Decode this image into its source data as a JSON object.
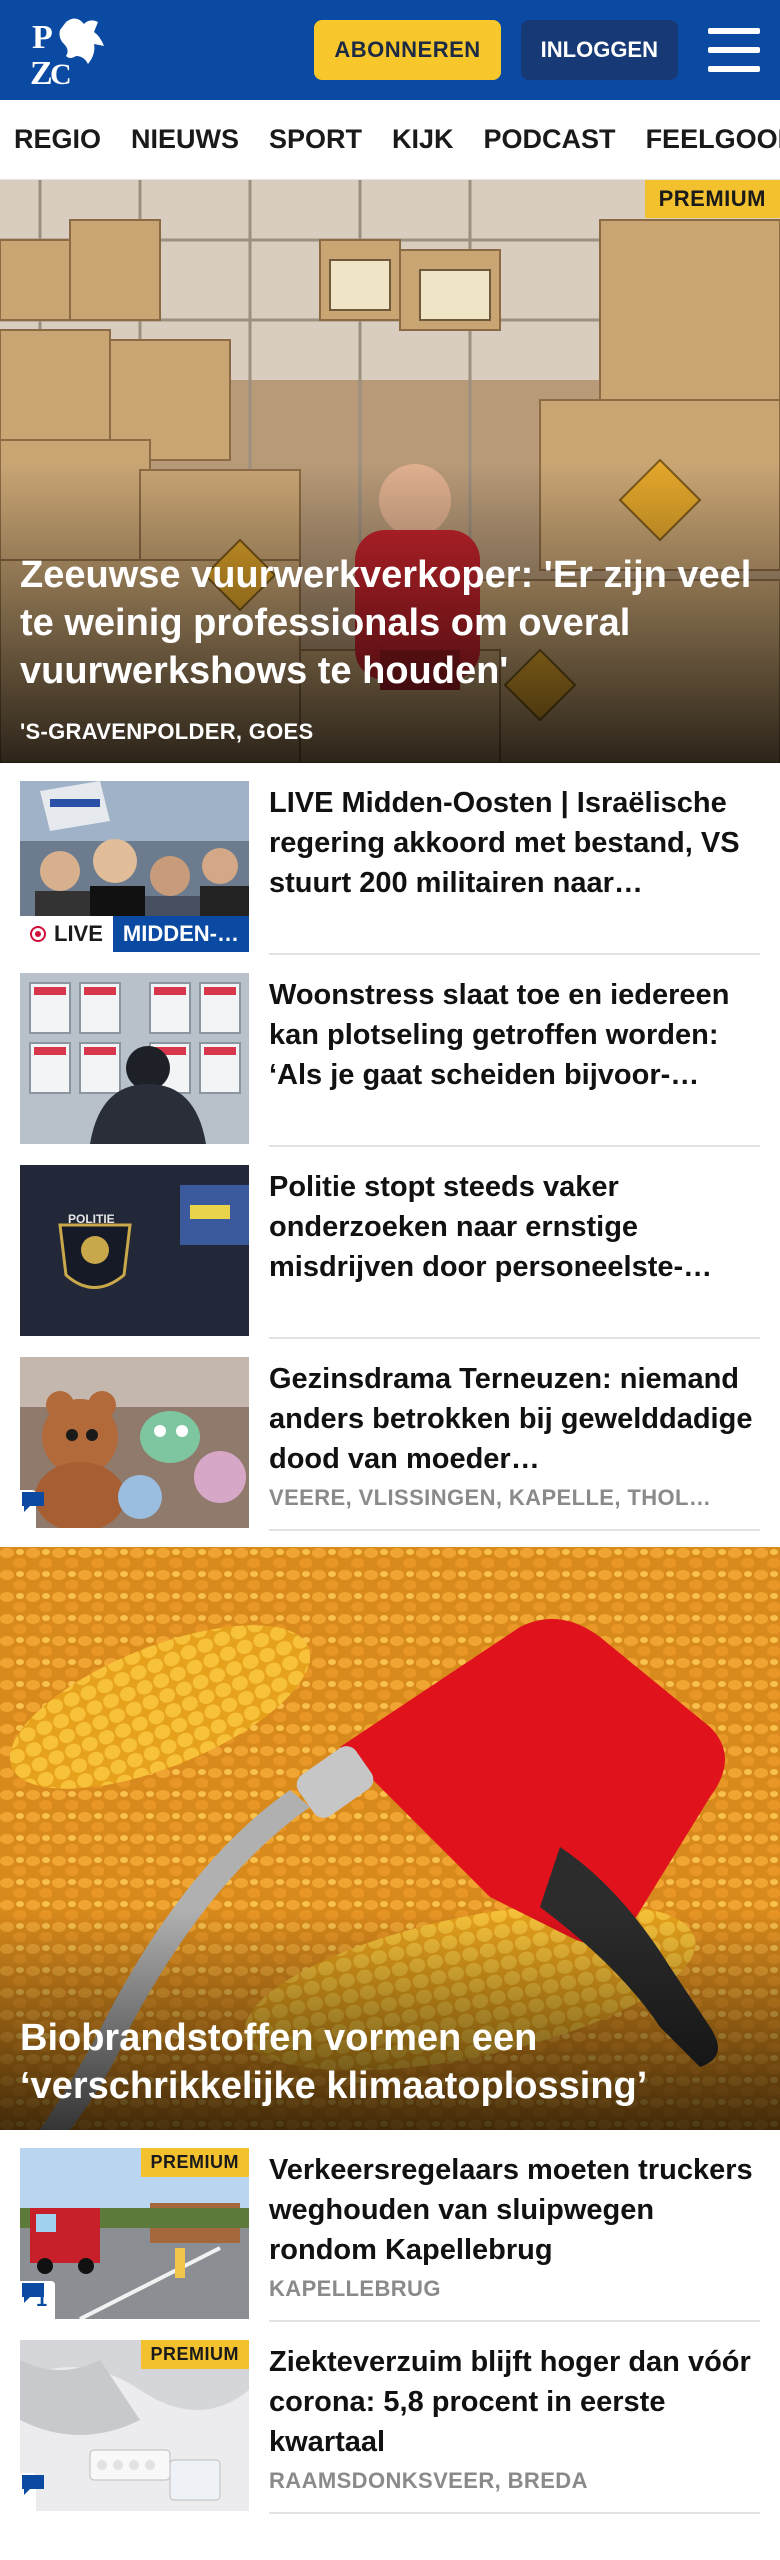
{
  "header": {
    "brand": "PZC",
    "subscribe_label": "ABONNEREN",
    "login_label": "INLOGGEN",
    "brand_color": "#0b4aa2",
    "accent_color": "#f7c72b"
  },
  "nav": {
    "items": [
      "REGIO",
      "NIEUWS",
      "SPORT",
      "KIJK",
      "PODCAST",
      "FEELGOOD"
    ],
    "more": "I"
  },
  "hero": {
    "badge": "PREMIUM",
    "title": "Zeeuwse vuurwerkverkoper: 'Er zijn veel te weinig professionals om overal vuurwerkshows te houden'",
    "location": "'S-GRAVENPOLDER, GOES"
  },
  "articles": [
    {
      "title": "LIVE Midden-Oosten | Israëlische regering akkoord met bestand, VS stuurt 200 militairen naar…",
      "live_label": "LIVE",
      "topic": "MIDDEN-…"
    },
    {
      "title": "Woonstress slaat toe en iedereen kan plotseling getroffen worden: ‘Als je gaat scheiden bijvoor-…"
    },
    {
      "title": "Politie stopt steeds vaker onderzoeken naar ernstige misdrijven door personeelste-…"
    },
    {
      "title": "Gezinsdrama Terneuzen: niemand anders betrokken bij gewelddadige dood van moeder…",
      "location": "VEERE, VLISSINGEN, KAPELLE, THOL…"
    }
  ],
  "feature": {
    "title": "Biobrandstoffen vormen een ‘verschrikkelijke klimaatoplossing’"
  },
  "articles2": [
    {
      "badge": "PREMIUM",
      "title": "Verkeersregelaars moeten truckers weghouden van sluipwegen rondom Kapellebrug",
      "location": "KAPELLEBRUG",
      "comments": "1"
    },
    {
      "badge": "PREMIUM",
      "title": "Ziekteverzuim blijft hoger dan vóór corona: 5,8 procent in eerste kwartaal",
      "location": "RAAMSDONKSVEER, BREDA"
    }
  ]
}
